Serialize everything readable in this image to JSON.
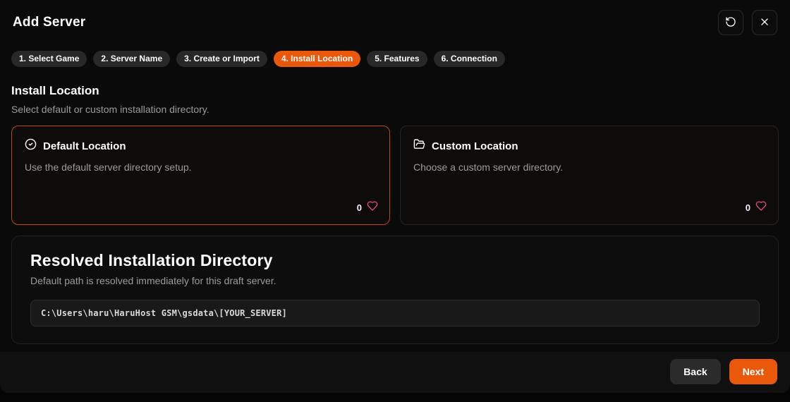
{
  "modal": {
    "title": "Add Server"
  },
  "header_actions": {
    "refresh_icon": "rotate-ccw-icon",
    "close_icon": "x-icon"
  },
  "steps": [
    {
      "label": "1. Select Game",
      "active": false
    },
    {
      "label": "2. Server Name",
      "active": false
    },
    {
      "label": "3. Create or Import",
      "active": false
    },
    {
      "label": "4. Install Location",
      "active": true
    },
    {
      "label": "5. Features",
      "active": false
    },
    {
      "label": "6. Connection",
      "active": false
    }
  ],
  "section": {
    "title": "Install Location",
    "subtitle": "Select default or custom installation directory."
  },
  "options": [
    {
      "icon": "check-circle-icon",
      "title": "Default Location",
      "description": "Use the default server directory setup.",
      "likes": "0",
      "selected": true
    },
    {
      "icon": "folder-open-icon",
      "title": "Custom Location",
      "description": "Choose a custom server directory.",
      "likes": "0",
      "selected": false
    }
  ],
  "resolved": {
    "title": "Resolved Installation Directory",
    "subtitle": "Default path is resolved immediately for this draft server.",
    "path": "C:\\Users\\haru\\HaruHost GSM\\gsdata\\[YOUR_SERVER]"
  },
  "footer": {
    "back_label": "Back",
    "next_label": "Next"
  },
  "colors": {
    "accent": "#ea580c",
    "selected_border": "#bb4a0f",
    "heart": "#e64980",
    "muted_text": "#9b9b9b",
    "pill_bg": "#282828",
    "modal_bg": "#0a0a0a"
  },
  "icons": {
    "heart": "heart-icon"
  }
}
